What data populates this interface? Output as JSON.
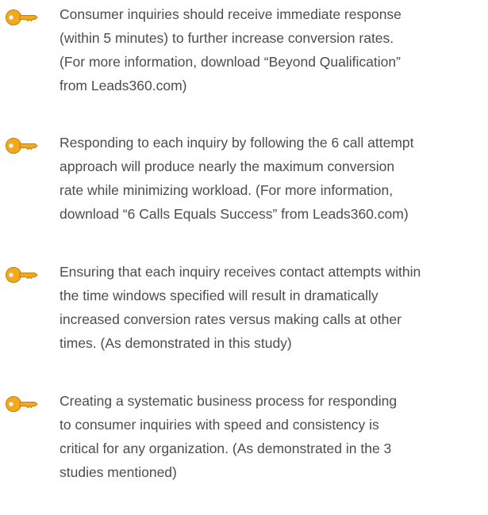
{
  "key_points": {
    "icon": "key-icon",
    "icon_color": "#f4a81d",
    "text_color": "#4d4d4d",
    "items": [
      {
        "lines": [
          "Consumer inquiries should receive immediate response",
          "(within 5 minutes) to further increase conversion rates.",
          "(For more information, download “Beyond Qualification”",
          "from Leads360.com)"
        ]
      },
      {
        "lines": [
          "Responding to each inquiry by following the 6 call attempt",
          "approach will produce nearly the maximum conversion",
          "rate while minimizing workload. (For more information,",
          "download “6 Calls Equals Success” from Leads360.com)"
        ]
      },
      {
        "lines": [
          "Ensuring that each inquiry receives contact attempts within",
          "the time windows specified will result in dramatically",
          "increased conversion rates versus making calls at other",
          "times. (As demonstrated in this study)"
        ]
      },
      {
        "lines": [
          "Creating a systematic business process for responding",
          "to consumer inquiries with speed and consistency is",
          "critical for any organization. (As demonstrated in the 3",
          "studies mentioned)"
        ]
      }
    ]
  }
}
